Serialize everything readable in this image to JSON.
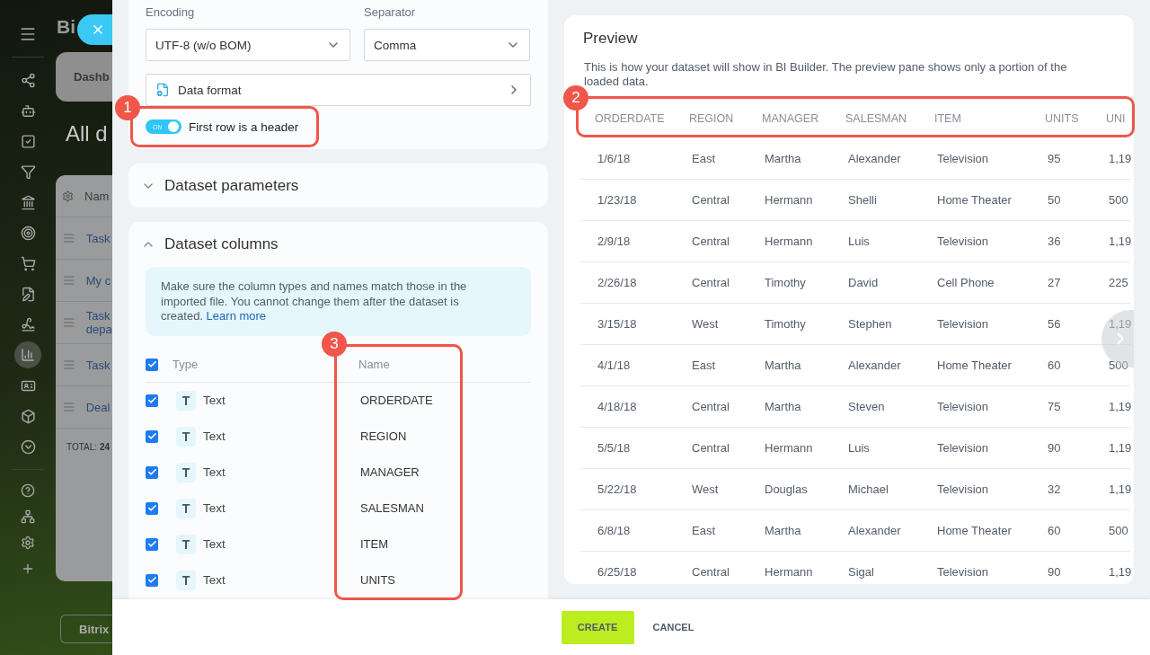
{
  "background_page": {
    "logo": "Bi",
    "tab": "Dashb",
    "title": "All d",
    "table_header": "Nam",
    "rows": [
      "Task",
      "My c",
      "Task depa",
      "Task",
      "Deal"
    ],
    "total": "TOTAL: **24**",
    "footer_button": "Bitrix"
  },
  "settings_card": {
    "encoding": {
      "label": "Encoding",
      "value": "UTF-8 (w/o BOM)"
    },
    "separator": {
      "label": "Separator",
      "value": "Comma"
    },
    "data_format": "Data format",
    "header_toggle": {
      "label": "First row is a header",
      "on": true,
      "state_text": "ON"
    }
  },
  "dataset_parameters": {
    "title": "Dataset parameters",
    "expanded": false
  },
  "dataset_columns": {
    "title": "Dataset columns",
    "expanded": true,
    "info": "Make sure the column types and names match those in the imported file. You cannot change them after the dataset is created.",
    "info_link": "Learn more",
    "header": {
      "checked": true,
      "type": "Type",
      "name": "Name"
    },
    "rows": [
      {
        "checked": true,
        "type_icon": "T",
        "type": "Text",
        "name": "ORDERDATE"
      },
      {
        "checked": true,
        "type_icon": "T",
        "type": "Text",
        "name": "REGION"
      },
      {
        "checked": true,
        "type_icon": "T",
        "type": "Text",
        "name": "MANAGER"
      },
      {
        "checked": true,
        "type_icon": "T",
        "type": "Text",
        "name": "SALESMAN"
      },
      {
        "checked": true,
        "type_icon": "T",
        "type": "Text",
        "name": "ITEM"
      },
      {
        "checked": true,
        "type_icon": "T",
        "type": "Text",
        "name": "UNITS"
      }
    ]
  },
  "preview": {
    "title": "Preview",
    "description": "This is how your dataset will show in BI Builder. The preview pane shows only a portion of the loaded data.",
    "columns": [
      "ORDERDATE",
      "REGION",
      "MANAGER",
      "SALESMAN",
      "ITEM",
      "UNITS",
      "UNI"
    ],
    "rows": [
      [
        "1/6/18",
        "East",
        "Martha",
        "Alexander",
        "Television",
        "95",
        "1,19"
      ],
      [
        "1/23/18",
        "Central",
        "Hermann",
        "Shelli",
        "Home Theater",
        "50",
        "500"
      ],
      [
        "2/9/18",
        "Central",
        "Hermann",
        "Luis",
        "Television",
        "36",
        "1,19"
      ],
      [
        "2/26/18",
        "Central",
        "Timothy",
        "David",
        "Cell Phone",
        "27",
        "225"
      ],
      [
        "3/15/18",
        "West",
        "Timothy",
        "Stephen",
        "Television",
        "56",
        "1,19"
      ],
      [
        "4/1/18",
        "East",
        "Martha",
        "Alexander",
        "Home Theater",
        "60",
        "500"
      ],
      [
        "4/18/18",
        "Central",
        "Martha",
        "Steven",
        "Television",
        "75",
        "1,19"
      ],
      [
        "5/5/18",
        "Central",
        "Hermann",
        "Luis",
        "Television",
        "90",
        "1,19"
      ],
      [
        "5/22/18",
        "West",
        "Douglas",
        "Michael",
        "Television",
        "32",
        "1,19"
      ],
      [
        "6/8/18",
        "East",
        "Martha",
        "Alexander",
        "Home Theater",
        "60",
        "500"
      ],
      [
        "6/25/18",
        "Central",
        "Hermann",
        "Sigal",
        "Television",
        "90",
        "1,19"
      ]
    ]
  },
  "annotations": [
    {
      "number": "1"
    },
    {
      "number": "2"
    },
    {
      "number": "3"
    }
  ],
  "footer": {
    "create": "CREATE",
    "cancel": "CANCEL"
  }
}
